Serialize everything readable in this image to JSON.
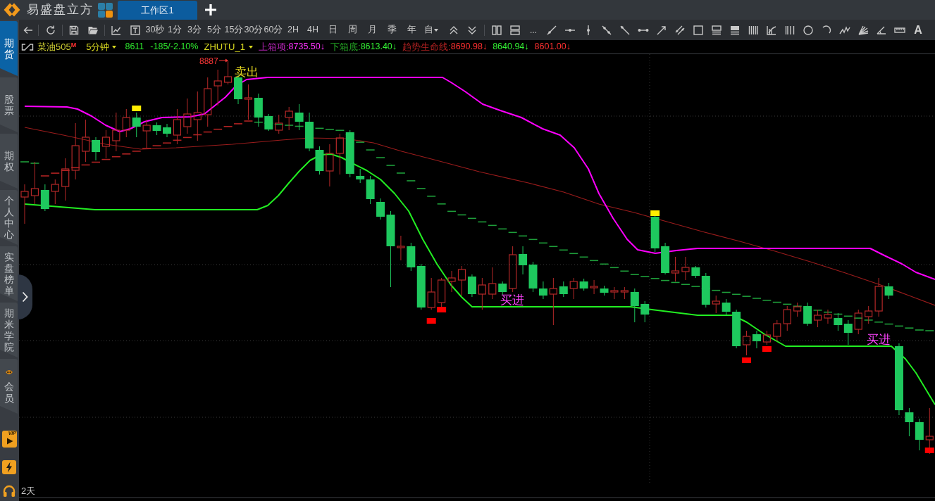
{
  "app": {
    "title": "易盛盘立方"
  },
  "tabs": [
    {
      "label": "工作区1",
      "selected": true
    }
  ],
  "sidebar": {
    "items": [
      {
        "label": "期货",
        "kind": "text",
        "selected": true
      },
      {
        "label": "股票",
        "kind": "text",
        "selected": false
      },
      {
        "label": "期权",
        "kind": "text",
        "selected": false
      },
      {
        "label": "个人中心",
        "kind": "text",
        "selected": false
      },
      {
        "label": "实盘榜单",
        "kind": "text",
        "selected": false
      },
      {
        "label": "期米学院",
        "kind": "text",
        "selected": false
      },
      {
        "label": "会员",
        "kind": "icon_text",
        "selected": false
      }
    ],
    "vip_badge": "VIP"
  },
  "toolbar": {
    "periods": [
      "30秒",
      "1分",
      "3分",
      "5分",
      "15分",
      "30分",
      "60分",
      "2H",
      "4H",
      "日",
      "周",
      "月",
      "季",
      "年"
    ],
    "custom_period": "自",
    "more": "...",
    "text_tool": "A"
  },
  "quote_bar": {
    "symbol": "菜油505",
    "market_flag": "M",
    "period": "5分钟",
    "last": "8611",
    "change": "-185/-2.10%",
    "indicator": "ZHUTU_1",
    "lines": [
      {
        "label": "上箱项:",
        "value": "8735.50↓",
        "color": "#ff33ff"
      },
      {
        "label": "下箱底:",
        "value": "8613.40↓",
        "color": "#33ee33"
      },
      {
        "label": "趋势生命线:",
        "value": "8690.98↓",
        "color": "#ff3030"
      },
      {
        "value": "8640.94↓",
        "color": "#33ee33"
      },
      {
        "value": "8601.00↓",
        "color": "#ff3030"
      }
    ]
  },
  "chart": {
    "labels": [
      {
        "kind": "high",
        "text": "8887"
      },
      {
        "kind": "sell",
        "text": "卖出"
      },
      {
        "kind": "buy",
        "text": "买进"
      },
      {
        "kind": "buy",
        "text": "买进"
      }
    ],
    "time_span": "2天"
  }
}
